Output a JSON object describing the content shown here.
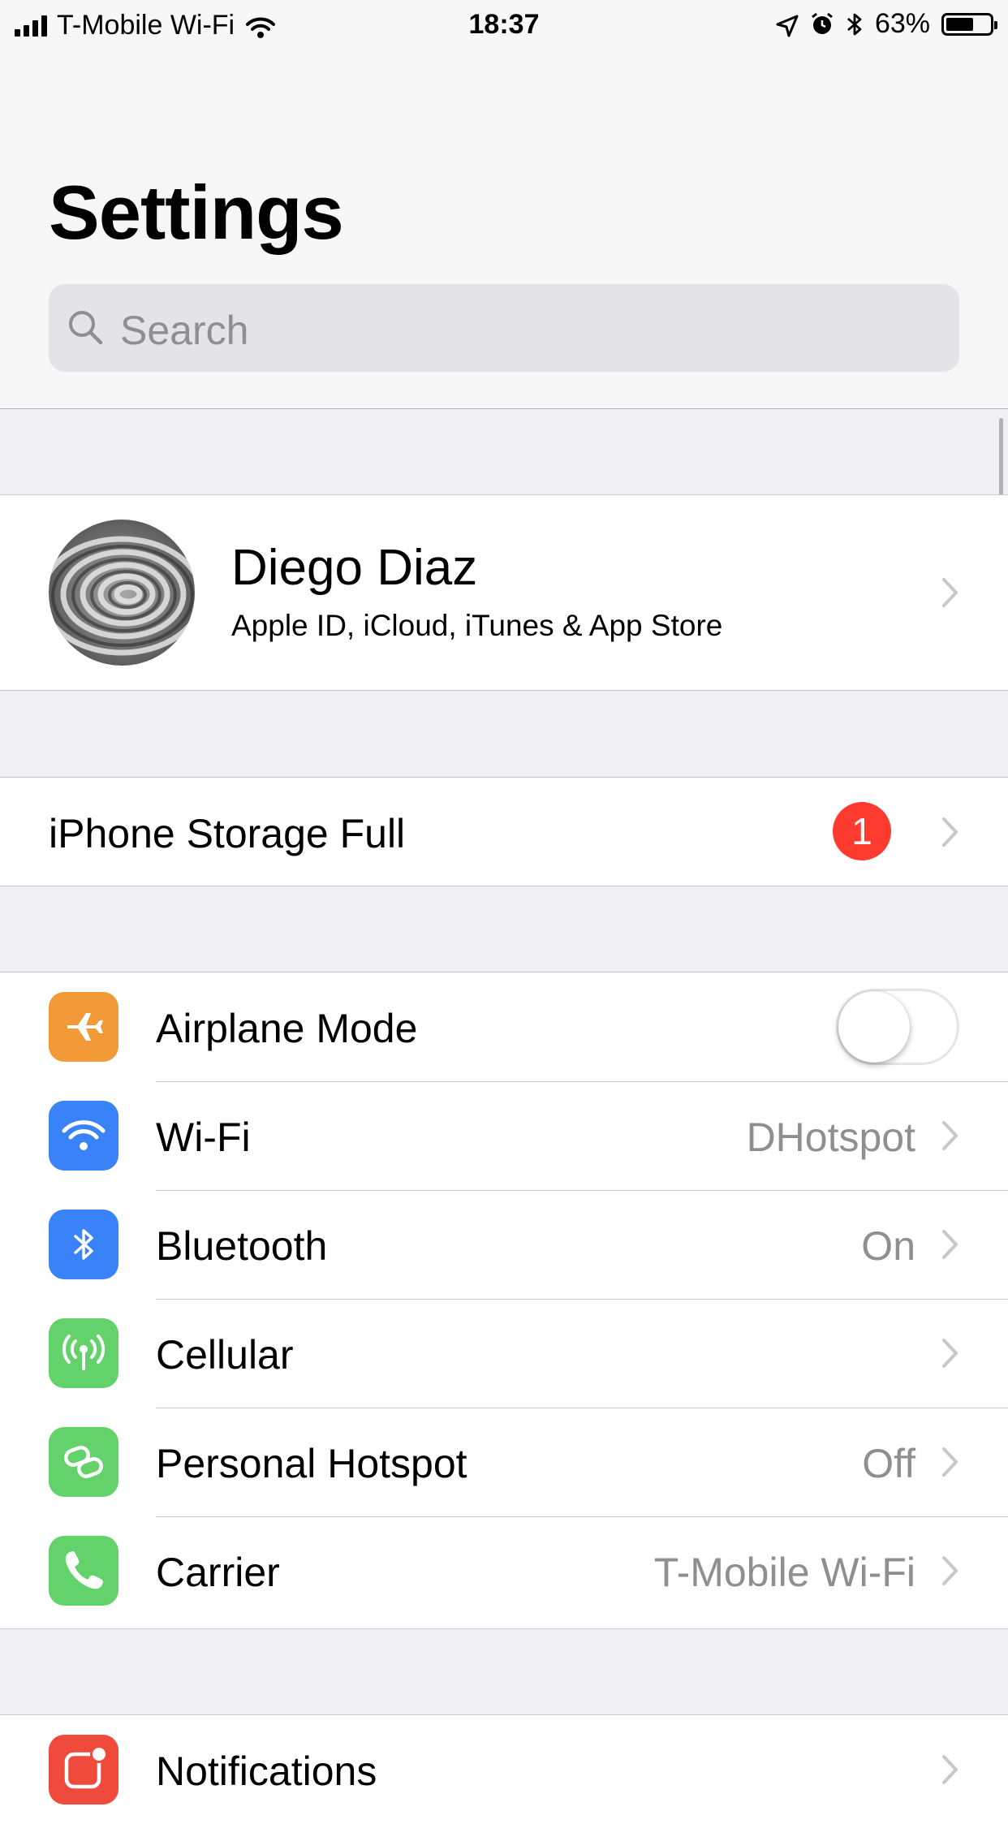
{
  "status_bar": {
    "carrier": "T-Mobile Wi-Fi",
    "time": "18:37",
    "battery_percent": "63%",
    "battery_level": 0.63,
    "icons": [
      "signal-icon",
      "wifi-icon",
      "location-arrow-icon",
      "alarm-icon",
      "bluetooth-icon",
      "battery-icon"
    ]
  },
  "header": {
    "title": "Settings",
    "search_placeholder": "Search"
  },
  "profile": {
    "name": "Diego Diaz",
    "subtitle": "Apple ID, iCloud, iTunes & App Store"
  },
  "storage": {
    "label": "iPhone Storage Full",
    "badge": "1"
  },
  "connectivity": [
    {
      "label": "Airplane Mode",
      "value": "",
      "icon": "airplane-icon",
      "color": "#f19a37",
      "toggle": false
    },
    {
      "label": "Wi-Fi",
      "value": "DHotspot",
      "icon": "wifi-icon",
      "color": "#3a82f7"
    },
    {
      "label": "Bluetooth",
      "value": "On",
      "icon": "bluetooth-icon",
      "color": "#3a82f7"
    },
    {
      "label": "Cellular",
      "value": "",
      "icon": "cellular-antenna-icon",
      "color": "#64d26a"
    },
    {
      "label": "Personal Hotspot",
      "value": "Off",
      "icon": "hotspot-link-icon",
      "color": "#64d26a"
    },
    {
      "label": "Carrier",
      "value": "T-Mobile Wi-Fi",
      "icon": "phone-icon",
      "color": "#64d26a"
    }
  ],
  "notifications": {
    "label": "Notifications",
    "icon": "notifications-icon",
    "color": "#f04a3d"
  },
  "colors": {
    "badge": "#ff3b30",
    "secondary_text": "#8e8e93",
    "chevron": "#c7c7cc"
  }
}
